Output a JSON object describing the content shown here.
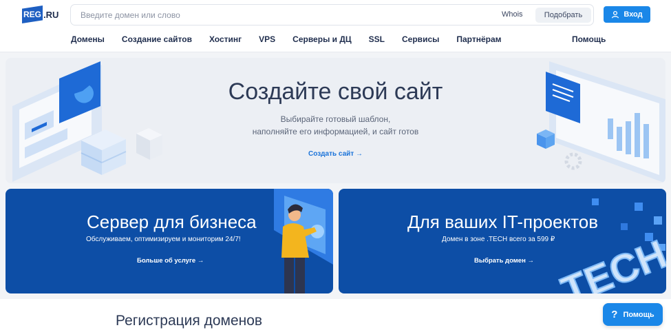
{
  "header": {
    "logo_mark": "REG",
    "logo_rest": ".RU",
    "search": {
      "placeholder": "Введите домен или слово"
    },
    "whois_label": "Whois",
    "pick_label": "Подобрать",
    "login_label": "Вход"
  },
  "nav": {
    "items": [
      "Домены",
      "Создание сайтов",
      "Хостинг",
      "VPS",
      "Серверы и ДЦ",
      "SSL",
      "Сервисы",
      "Партнёрам"
    ],
    "help": "Помощь"
  },
  "hero": {
    "title": "Создайте свой сайт",
    "subtitle_line1": "Выбирайте готовый шаблон,",
    "subtitle_line2": "наполняйте его информацией, и сайт готов",
    "link": "Создать сайт →"
  },
  "cards": [
    {
      "title": "Сервер для бизнеса",
      "subtitle": "Обслуживаем, оптимизируем и мониторим 24/7!",
      "link": "Больше об услуге →"
    },
    {
      "title": "Для ваших IT-проектов",
      "subtitle": "Домен в зоне .TECH всего за 599 ₽",
      "link": "Выбрать домен →",
      "art_text": "TECH"
    }
  ],
  "section": {
    "title": "Регистрация доменов"
  },
  "help_button": {
    "icon_glyph": "?",
    "label": "Помощь"
  },
  "colors": {
    "brand": "#1e5fc2",
    "accent": "#1a87e8",
    "card_bg": "#0d4ea6",
    "link": "#1a73d9"
  }
}
